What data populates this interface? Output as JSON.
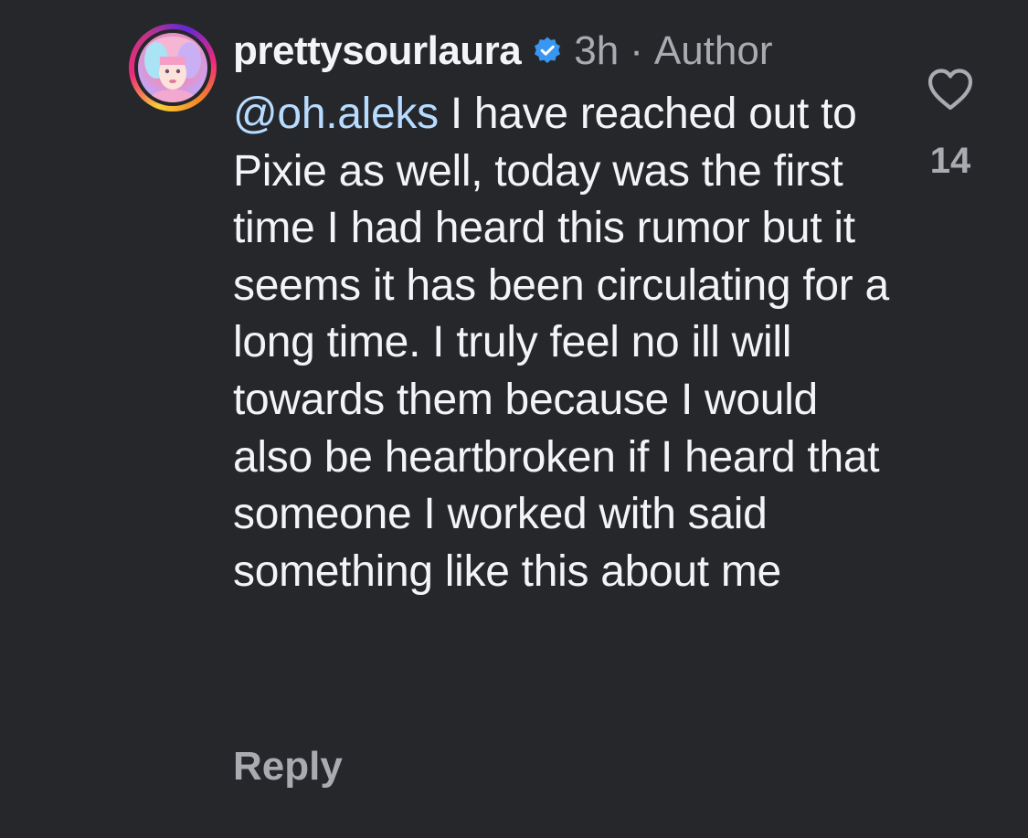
{
  "comment": {
    "username": "prettysourlaura",
    "verified": true,
    "verified_icon": "verified-badge-icon",
    "time_ago": "3h",
    "separator": "·",
    "role_label": "Author",
    "mention": "@oh.aleks",
    "body": " I have reached out to Pixie as well, today was the first time I had heard this rumor but it seems it has been circulating for a long time. I truly feel no ill will towards them because I would also be heartbroken if I heard that someone I worked with said something like this about me",
    "reply_label": "Reply",
    "like_icon": "heart-outline-icon",
    "like_count": "14"
  },
  "colors": {
    "background": "#25272b",
    "text": "#f3f4f6",
    "muted": "#a9abb0",
    "mention": "#b8dcff",
    "verified_blue": "#3897f0"
  }
}
